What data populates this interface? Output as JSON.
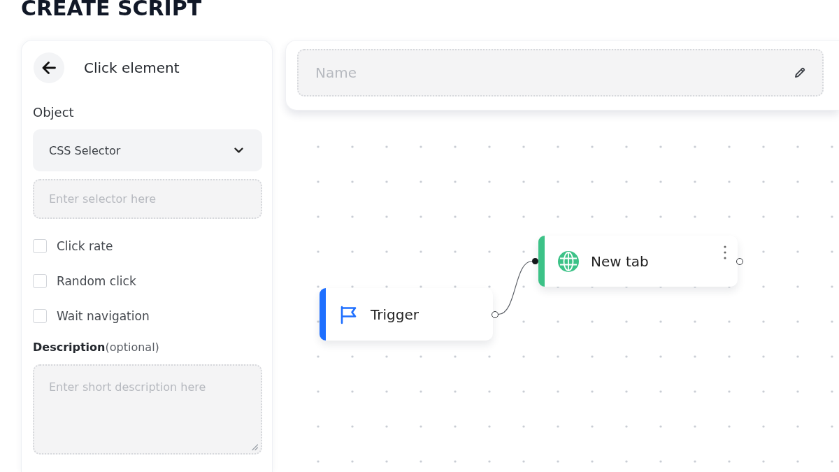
{
  "page_title": "CREATE SCRIPT",
  "panel": {
    "title": "Click element",
    "object_label": "Object",
    "object_select": {
      "value": "CSS Selector"
    },
    "selector_input": {
      "placeholder": "Enter selector here"
    },
    "options": [
      {
        "label": "Click rate",
        "checked": false
      },
      {
        "label": "Random click",
        "checked": false
      },
      {
        "label": "Wait navigation",
        "checked": false
      }
    ],
    "description_label": "**Description**(optional)",
    "description_input": {
      "placeholder": "Enter short description here"
    }
  },
  "name_input": {
    "placeholder": "Name"
  },
  "nodes": [
    {
      "label": "Trigger",
      "kind": "trigger",
      "color": "#1e6fff"
    },
    {
      "label": "New tab",
      "kind": "new_tab",
      "color": "#3cc287"
    }
  ]
}
